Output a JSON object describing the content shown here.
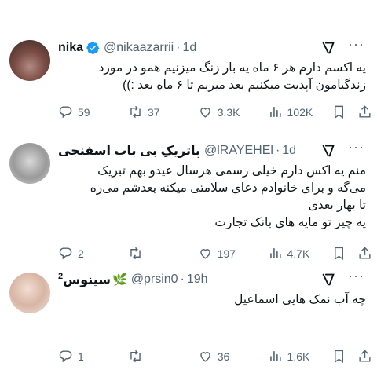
{
  "tweets": [
    {
      "name": "nika",
      "handle": "@nikaazarrii",
      "time": "1d",
      "verified": true,
      "text_lines": [
        "یه اکسم دارم هر ۶ ماه یه بار زنگ میزنیم همو در مورد",
        "زندگیامون آپدیت میکنیم بعد میریم تا ۶ ماه بعد :))"
      ],
      "replies": "59",
      "reposts": "37",
      "likes": "3.3K",
      "views": "102K"
    },
    {
      "name": "پاتریکِ بی باب اسفنجی",
      "handle": "@lRAYEHEl",
      "time": "1d",
      "verified": false,
      "text_lines": [
        "منم یه اکس دارم خیلی رسمی هرسال عیدو بهم تبریک",
        "می‌گه و برای خانوادم دعای سلامتی میکنه بعدشم می‌ره",
        "تا بهار بعدی",
        "یه چیز تو مایه های بانک تجارت"
      ],
      "replies": "2",
      "reposts": "",
      "likes": "197",
      "views": "4.7K"
    },
    {
      "name": "سینوس",
      "name_sup": "2",
      "name_emoji": "🌿",
      "handle": "@prsin0",
      "time": "19h",
      "verified": false,
      "text_lines": [
        "چه آب نمک هایی اسماعیل"
      ],
      "replies": "1",
      "reposts": "",
      "likes": "36",
      "views": "1.6K"
    }
  ],
  "icons": {
    "verified": "verified-badge-icon",
    "grok": "grok-icon",
    "more": "more-options-icon",
    "reply": "reply-icon",
    "repost": "repost-icon",
    "like": "like-icon",
    "views": "views-icon",
    "bookmark": "bookmark-icon",
    "share": "share-icon"
  },
  "colors": {
    "accent": "#1d9bf0",
    "muted": "#536471",
    "text": "#0f1419"
  },
  "separator": "·",
  "more_glyph": "···"
}
